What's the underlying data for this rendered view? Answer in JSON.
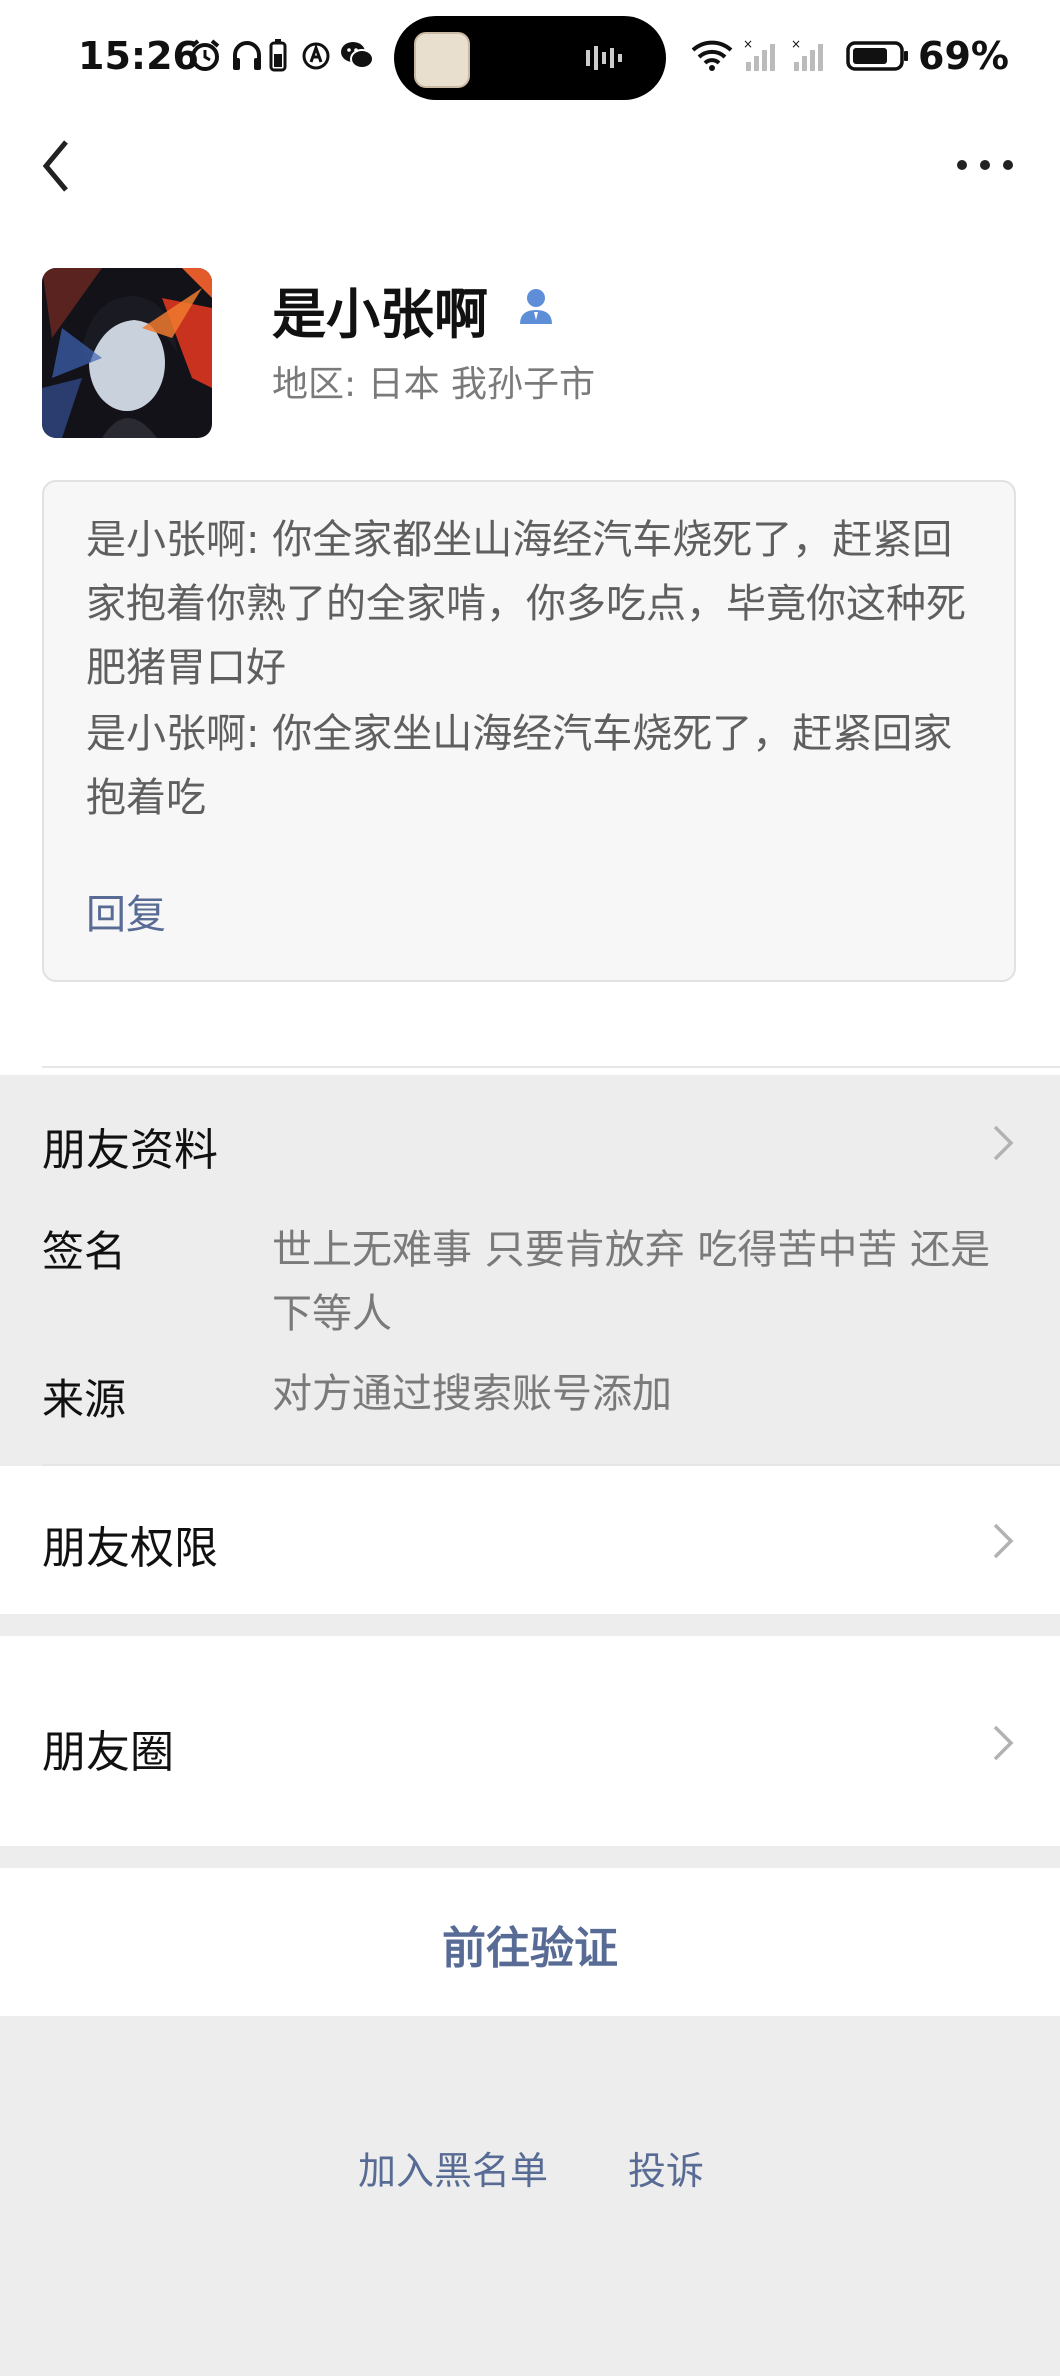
{
  "status_bar": {
    "time": "15:26",
    "battery_percent": "69%",
    "icons": [
      "alarm-icon",
      "headphones-icon",
      "battery-saver-icon",
      "mobile-data-icon",
      "wechat-icon",
      "wifi-icon",
      "signal-icon",
      "signal-icon",
      "battery-icon"
    ]
  },
  "nav": {
    "back_icon": "back-chevron-icon",
    "more_icon": "more-dots-icon"
  },
  "profile": {
    "name": "是小张啊",
    "region": "地区:  日本  我孙子市",
    "contact_icon": "contact-person-icon"
  },
  "messages": [
    {
      "text": "是小张啊: 你全家都坐山海经汽车烧死了，赶紧回家抱着你熟了的全家啃，你多吃点，毕竟你这种死肥猪胃口好"
    },
    {
      "text": "是小张啊: 你全家坐山海经汽车烧死了，赶紧回家抱着吃"
    }
  ],
  "reply_label": "回复",
  "friend_info": {
    "title": "朋友资料",
    "signature_label": "签名",
    "signature_value": "世上无难事 只要肯放弃 吃得苦中苦 还是下等人",
    "source_label": "来源",
    "source_value": "对方通过搜索账号添加"
  },
  "permissions_title": "朋友权限",
  "moments_title": "朋友圈",
  "verify_button": "前往验证",
  "bottom_links": {
    "blacklist": "加入黑名单",
    "report": "投诉"
  },
  "colors": {
    "link": "#576b95",
    "background": "#ededed",
    "card": "#ffffff"
  }
}
